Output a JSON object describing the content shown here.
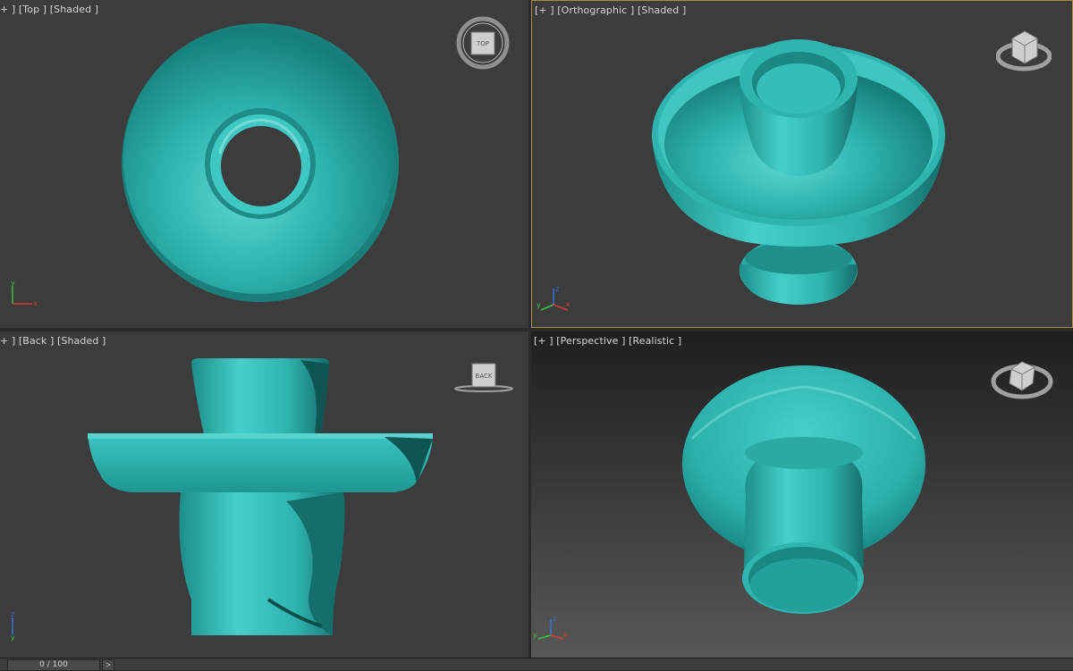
{
  "colors": {
    "background": "#2b2b2b",
    "viewport_bg": "#3c3c3c",
    "active_border": "#a58f43",
    "model": "#2fb4b0",
    "label_text": "#d6d6d6"
  },
  "viewports": {
    "top": {
      "label": "+ ] [Top ] [Shaded ]",
      "navcube": "TOP",
      "active": false
    },
    "orthographic": {
      "label": "[+ ] [Orthographic ] [Shaded ]",
      "active": true
    },
    "back": {
      "label": "+ ] [Back ] [Shaded ]",
      "navcube": "BACK",
      "active": false
    },
    "perspective": {
      "label": "[+ ] [Perspective ] [Realistic ]",
      "active": false
    }
  },
  "axis": {
    "x": "x",
    "y": "y",
    "z": "z"
  },
  "timeline": {
    "slider_text": "0 / 100",
    "next_label": ">"
  }
}
